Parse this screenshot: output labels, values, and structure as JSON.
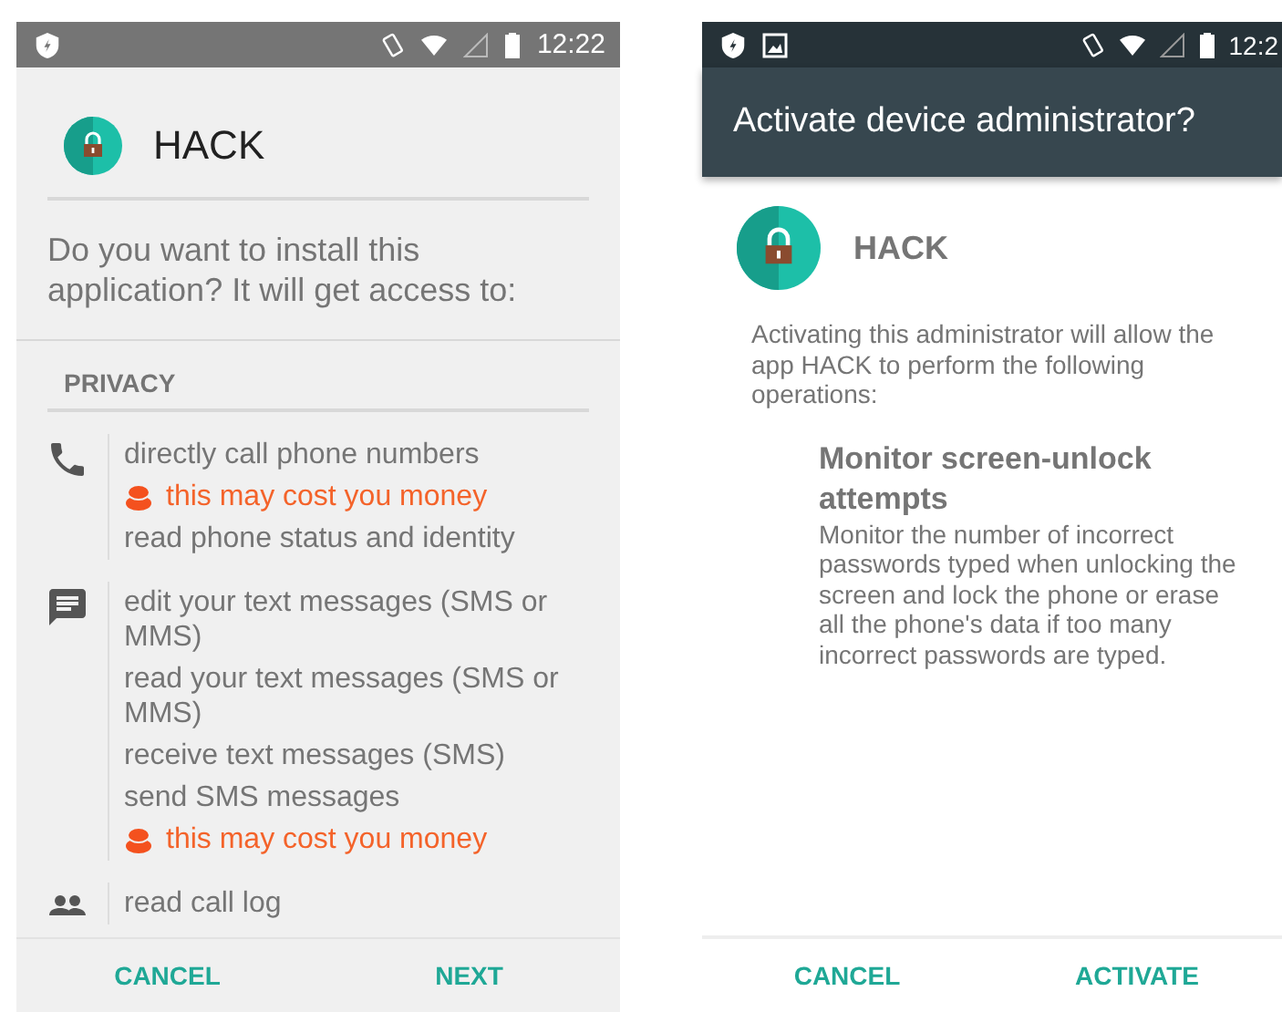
{
  "install_screen": {
    "status_bar": {
      "notifications": [
        {
          "kind": "shield"
        }
      ],
      "time": "12:22"
    },
    "app_name": "HACK",
    "question": "Do you want to install this application? It will get access to:",
    "section_title": "PRIVACY",
    "groups": [
      {
        "kind": "phone",
        "items": [
          {
            "kind": "permission",
            "text": "directly call phone numbers"
          },
          {
            "kind": "warning",
            "text": "this may cost you money"
          },
          {
            "kind": "permission",
            "text": "read phone status and identity"
          }
        ]
      },
      {
        "kind": "message",
        "items": [
          {
            "kind": "permission",
            "text": "edit your text messages (SMS or MMS)"
          },
          {
            "kind": "permission",
            "text": "read your text messages (SMS or MMS)"
          },
          {
            "kind": "permission",
            "text": "receive text messages (SMS)"
          },
          {
            "kind": "permission",
            "text": "send SMS messages"
          },
          {
            "kind": "warning",
            "text": "this may cost you money"
          }
        ]
      },
      {
        "kind": "people",
        "items": [
          {
            "kind": "permission",
            "text": "read call log"
          }
        ]
      }
    ],
    "buttons": [
      "CANCEL",
      "NEXT"
    ]
  },
  "admin_screen": {
    "status_bar": {
      "notifications": [
        {
          "kind": "shield"
        },
        {
          "kind": "image"
        }
      ],
      "time": "12:2"
    },
    "title": "Activate device administrator?",
    "app_name": "HACK",
    "description": "Activating this administrator will allow the app HACK to perform the following operations:",
    "policies": [
      {
        "title": "Monitor screen-unlock attempts",
        "text": "Monitor the number of incorrect passwords typed when unlocking the screen and lock the phone or erase all the phone's data if too many incorrect passwords are typed."
      }
    ],
    "buttons": [
      "CANCEL",
      "ACTIVATE"
    ]
  }
}
